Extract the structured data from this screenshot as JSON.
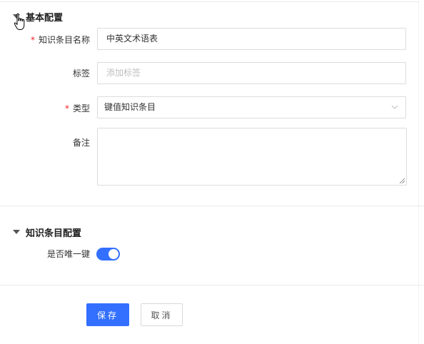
{
  "basic_section": {
    "title": "基本配置"
  },
  "form": {
    "name": {
      "label": "知识条目名称",
      "value": "中英文术语表"
    },
    "tags": {
      "label": "标签",
      "placeholder": "添加标签"
    },
    "type": {
      "label": "类型",
      "value": "键值知识条目"
    },
    "remark": {
      "label": "备注"
    }
  },
  "knowledge_section": {
    "title": "知识条目配置",
    "unique_key": {
      "label": "是否唯一键",
      "enabled": true
    }
  },
  "actions": {
    "save_label": "保存",
    "cancel_label": "取消"
  },
  "colors": {
    "primary": "#3370ff",
    "required": "#f5222d",
    "border": "#dcdcdc"
  },
  "icons": [
    "caret-down-icon",
    "chevron-down-icon",
    "resize-grip-icon",
    "hand-pointer-cursor"
  ]
}
